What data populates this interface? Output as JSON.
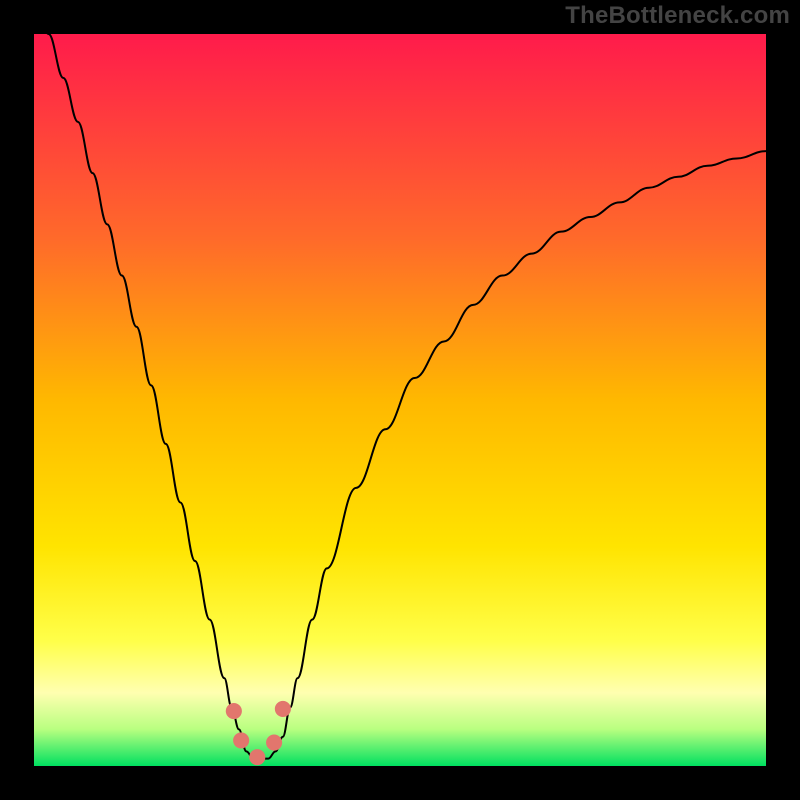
{
  "watermark": "TheBottleneck.com",
  "chart_data": {
    "type": "line",
    "title": "",
    "xlabel": "",
    "ylabel": "",
    "xlim": [
      0,
      100
    ],
    "ylim": [
      0,
      100
    ],
    "grid": false,
    "background_gradient": {
      "top": "#ff1b4b",
      "mid": "#ffb800",
      "low": "#ffff4a",
      "band": "#ffffb0",
      "bottom": "#00e060"
    },
    "series": [
      {
        "name": "bottleneck-curve",
        "color": "#000000",
        "x": [
          0,
          2,
          4,
          6,
          8,
          10,
          12,
          14,
          16,
          18,
          20,
          22,
          24,
          26,
          27,
          28,
          29,
          30,
          31,
          32,
          33,
          34,
          35,
          36,
          38,
          40,
          44,
          48,
          52,
          56,
          60,
          64,
          68,
          72,
          76,
          80,
          84,
          88,
          92,
          96,
          100
        ],
        "y": [
          105,
          100,
          94,
          88,
          81,
          74,
          67,
          60,
          52,
          44,
          36,
          28,
          20,
          12,
          8,
          5,
          2,
          1,
          1,
          1,
          2,
          4,
          8,
          12,
          20,
          27,
          38,
          46,
          53,
          58,
          63,
          67,
          70,
          73,
          75,
          77,
          79,
          80.5,
          82,
          83,
          84
        ]
      }
    ],
    "markers": {
      "name": "bottleneck-markers",
      "color": "#e2766d",
      "radius_frac": 0.011,
      "points": [
        {
          "x": 27.3,
          "y": 7.5
        },
        {
          "x": 28.3,
          "y": 3.5
        },
        {
          "x": 30.5,
          "y": 1.2
        },
        {
          "x": 32.8,
          "y": 3.2
        },
        {
          "x": 34.0,
          "y": 7.8
        }
      ]
    }
  }
}
